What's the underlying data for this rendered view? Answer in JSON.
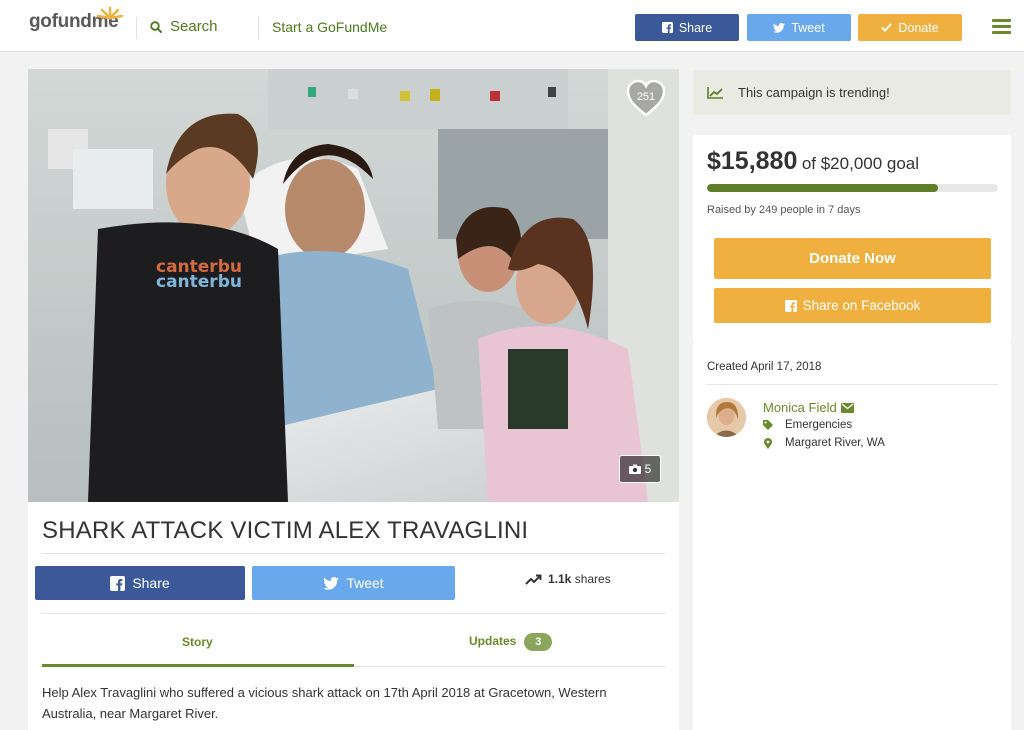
{
  "nav": {
    "logo": {
      "go": "go",
      "fund": "fund",
      "me": "me"
    },
    "search_label": "Search",
    "start_label": "Start a GoFundMe",
    "share_label": "Share",
    "tweet_label": "Tweet",
    "donate_label": "Donate"
  },
  "hero": {
    "hearts": "251",
    "photo_count": "5"
  },
  "campaign": {
    "title": "SHARK ATTACK VICTIM ALEX TRAVAGLINI",
    "share_label": "Share",
    "tweet_label": "Tweet",
    "shares_count": "1.1k",
    "shares_suffix": "shares",
    "tabs": [
      {
        "label": "Story",
        "active": true
      },
      {
        "label": "Updates",
        "badge": "3"
      }
    ],
    "story_text": "Help Alex Travaglini who suffered a vicious shark attack on 17th April 2018 at Gracetown, Western Australia, near Margaret River."
  },
  "sidebar": {
    "trending_text": "This campaign is trending!",
    "raised_amount": "$15,880",
    "goal_text": "of $20,000 goal",
    "progress_fraction": 0.794,
    "raised_by": "Raised by 249 people in 7 days",
    "donate_now_label": "Donate Now",
    "share_facebook_label": "Share on Facebook",
    "created": "Created April 17, 2018",
    "organizer_name": "Monica Field",
    "category": "Emergencies",
    "location": "Margaret River, WA"
  },
  "colors": {
    "brand_green": "#6a8a2c",
    "facebook": "#3b5998",
    "twitter": "#6aa8ec",
    "donate": "#f0b03f"
  }
}
